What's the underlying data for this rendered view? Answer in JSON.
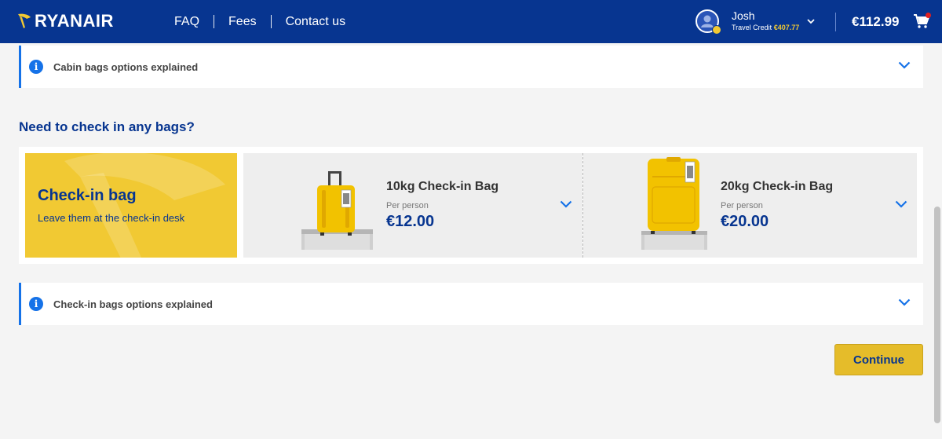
{
  "header": {
    "logo": "RYANAIR",
    "nav": [
      "FAQ",
      "Fees",
      "Contact us"
    ],
    "user_name": "Josh",
    "credit_label": "Travel Credit",
    "credit_value": "€407.77",
    "total": "€112.99",
    "colors": {
      "brand_blue": "#073590",
      "accent_yellow": "#f1c933"
    },
    "icons": [
      "avatar-icon",
      "chevron-down-icon",
      "cart-icon"
    ]
  },
  "cabin_panel": {
    "title": "Cabin bags options explained"
  },
  "section": {
    "title": "Need to check in any bags?"
  },
  "hero": {
    "title": "Check-in bag",
    "subtitle": "Leave them at the check-in desk"
  },
  "bags": [
    {
      "name": "10kg Check-in Bag",
      "per": "Per person",
      "price": "€12.00"
    },
    {
      "name": "20kg Check-in Bag",
      "per": "Per person",
      "price": "€20.00"
    }
  ],
  "checkin_panel": {
    "title": "Check-in bags options explained"
  },
  "actions": {
    "continue": "Continue"
  }
}
